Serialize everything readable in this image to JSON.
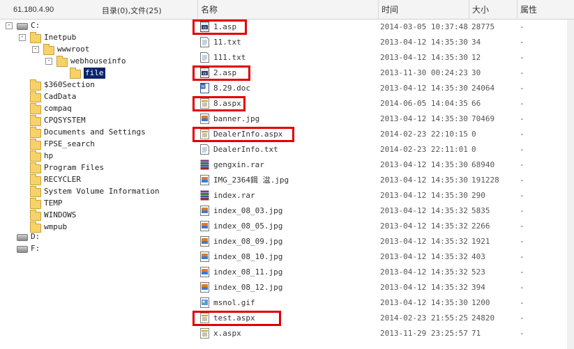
{
  "topbar": {
    "ip": "61.180.4.90",
    "counts": "目录(0),文件(25)"
  },
  "columns": {
    "name": "名称",
    "time": "时间",
    "size": "大小",
    "attr": "属性"
  },
  "tree": [
    {
      "label": "C:",
      "type": "drive",
      "level": 0,
      "toggle": "-"
    },
    {
      "label": "Inetpub",
      "type": "folder",
      "level": 1,
      "toggle": "-"
    },
    {
      "label": "wwwroot",
      "type": "folder",
      "level": 2,
      "toggle": "-"
    },
    {
      "label": "webhouseinfo",
      "type": "folder",
      "level": 3,
      "toggle": "-"
    },
    {
      "label": "file",
      "type": "folder",
      "level": 4,
      "toggle": "",
      "selected": true
    },
    {
      "label": "$360Section",
      "type": "folder",
      "level": 1,
      "toggle": ""
    },
    {
      "label": "CadData",
      "type": "folder",
      "level": 1,
      "toggle": ""
    },
    {
      "label": "compaq",
      "type": "folder",
      "level": 1,
      "toggle": ""
    },
    {
      "label": "CPQSYSTEM",
      "type": "folder",
      "level": 1,
      "toggle": ""
    },
    {
      "label": "Documents and Settings",
      "type": "folder",
      "level": 1,
      "toggle": ""
    },
    {
      "label": "FPSE_search",
      "type": "folder",
      "level": 1,
      "toggle": ""
    },
    {
      "label": "hp",
      "type": "folder",
      "level": 1,
      "toggle": ""
    },
    {
      "label": "Program Files",
      "type": "folder",
      "level": 1,
      "toggle": ""
    },
    {
      "label": "RECYCLER",
      "type": "folder",
      "level": 1,
      "toggle": ""
    },
    {
      "label": "System Volume Information",
      "type": "folder",
      "level": 1,
      "toggle": ""
    },
    {
      "label": "TEMP",
      "type": "folder",
      "level": 1,
      "toggle": ""
    },
    {
      "label": "WINDOWS",
      "type": "folder",
      "level": 1,
      "toggle": ""
    },
    {
      "label": "wmpub",
      "type": "folder",
      "level": 1,
      "toggle": ""
    },
    {
      "label": "D:",
      "type": "drive",
      "level": 0,
      "toggle": ""
    },
    {
      "label": "F:",
      "type": "drive",
      "level": 0,
      "toggle": ""
    }
  ],
  "files": [
    {
      "name": "1.asp",
      "time": "2014-03-05 10:37:48",
      "size": "28775",
      "attr": "-",
      "icon": "asp-icon",
      "highlight": true
    },
    {
      "name": "11.txt",
      "time": "2013-04-12 14:35:30",
      "size": "34",
      "attr": "-",
      "icon": "txt-icon"
    },
    {
      "name": "111.txt",
      "time": "2013-04-12 14:35:30",
      "size": "12",
      "attr": "-",
      "icon": "txt-icon"
    },
    {
      "name": "2.asp",
      "time": "2013-11-30 00:24:23",
      "size": "30",
      "attr": "-",
      "icon": "asp-icon",
      "highlight": true
    },
    {
      "name": "8.29.doc",
      "time": "2013-04-12 14:35:30",
      "size": "24064",
      "attr": "-",
      "icon": "doc-icon"
    },
    {
      "name": "8.aspx",
      "time": "2014-06-05 14:04:35",
      "size": "66",
      "attr": "-",
      "icon": "aspx-icon",
      "highlight": true
    },
    {
      "name": "banner.jpg",
      "time": "2013-04-12 14:35:30",
      "size": "70469",
      "attr": "-",
      "icon": "image-icon"
    },
    {
      "name": "DealerInfo.aspx",
      "time": "2014-02-23 22:10:15",
      "size": "0",
      "attr": "-",
      "icon": "aspx-icon",
      "highlight": true
    },
    {
      "name": "DealerInfo.txt",
      "time": "2014-02-23 22:11:01",
      "size": "0",
      "attr": "-",
      "icon": "txt-icon"
    },
    {
      "name": "gengxin.rar",
      "time": "2013-04-12 14:35:30",
      "size": "68940",
      "attr": "-",
      "icon": "rar-icon"
    },
    {
      "name": "IMG_2364鍓  湓.jpg",
      "time": "2013-04-12 14:35:30",
      "size": "191228",
      "attr": "-",
      "icon": "image-icon"
    },
    {
      "name": "index.rar",
      "time": "2013-04-12 14:35:30",
      "size": "290",
      "attr": "-",
      "icon": "rar-icon"
    },
    {
      "name": "index_08_03.jpg",
      "time": "2013-04-12 14:35:32",
      "size": "5835",
      "attr": "-",
      "icon": "image-icon"
    },
    {
      "name": "index_08_05.jpg",
      "time": "2013-04-12 14:35:32",
      "size": "2266",
      "attr": "-",
      "icon": "image-icon"
    },
    {
      "name": "index_08_09.jpg",
      "time": "2013-04-12 14:35:32",
      "size": "1921",
      "attr": "-",
      "icon": "image-icon"
    },
    {
      "name": "index_08_10.jpg",
      "time": "2013-04-12 14:35:32",
      "size": "403",
      "attr": "-",
      "icon": "image-icon"
    },
    {
      "name": "index_08_11.jpg",
      "time": "2013-04-12 14:35:32",
      "size": "523",
      "attr": "-",
      "icon": "image-icon"
    },
    {
      "name": "index_08_12.jpg",
      "time": "2013-04-12 14:35:32",
      "size": "394",
      "attr": "-",
      "icon": "image-icon"
    },
    {
      "name": "msnol.gif",
      "time": "2013-04-12 14:35:30",
      "size": "1200",
      "attr": "-",
      "icon": "gif-icon"
    },
    {
      "name": "test.aspx",
      "time": "2014-02-23 21:55:25",
      "size": "24820",
      "attr": "-",
      "icon": "aspx-icon",
      "highlight": true
    },
    {
      "name": "x.aspx",
      "time": "2013-11-29 23:25:57",
      "size": "71",
      "attr": "-",
      "icon": "aspx-icon"
    }
  ],
  "colors": {
    "highlight": "#e00000",
    "selection": "#0a246a"
  }
}
